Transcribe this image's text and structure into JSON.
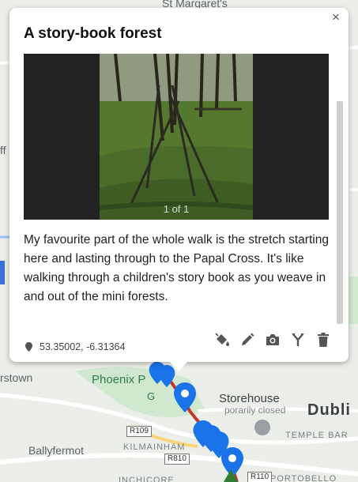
{
  "popup": {
    "title": "A story-book forest",
    "close_glyph": "×",
    "photo_counter": "1 of 1",
    "description": "My favourite part of the whole walk is the stretch starting here and lasting through to the Papal Cross. It's like walking through a children's story book as you weave in and out of the mini forests.",
    "coordinates": "53.35002, -6.31364",
    "toolbar": {
      "fill_icon": "paint-bucket-icon",
      "edit_icon": "pencil-icon",
      "photo_icon": "camera-icon",
      "split_icon": "fork-icon",
      "delete_icon": "trash-icon"
    }
  },
  "map": {
    "labels": {
      "top": "St Margaret's",
      "left_a": "ff",
      "left_b": "rstown",
      "park": "Phoenix P",
      "park_gate": "G",
      "storehouse": "Storehouse",
      "closed": "porarily closed",
      "city": "Dubli",
      "temple_bar": "TEMPLE BAR",
      "ballyfermot": "Ballyfermot",
      "kilmainham": "KILMAINHAM",
      "portobello": "PORTOBELLO",
      "bottom": "INCHICORE"
    },
    "roads": [
      "R109",
      "R810",
      "R110"
    ]
  },
  "colors": {
    "pin_blue": "#1a73e8",
    "route_red": "#c0392b"
  }
}
